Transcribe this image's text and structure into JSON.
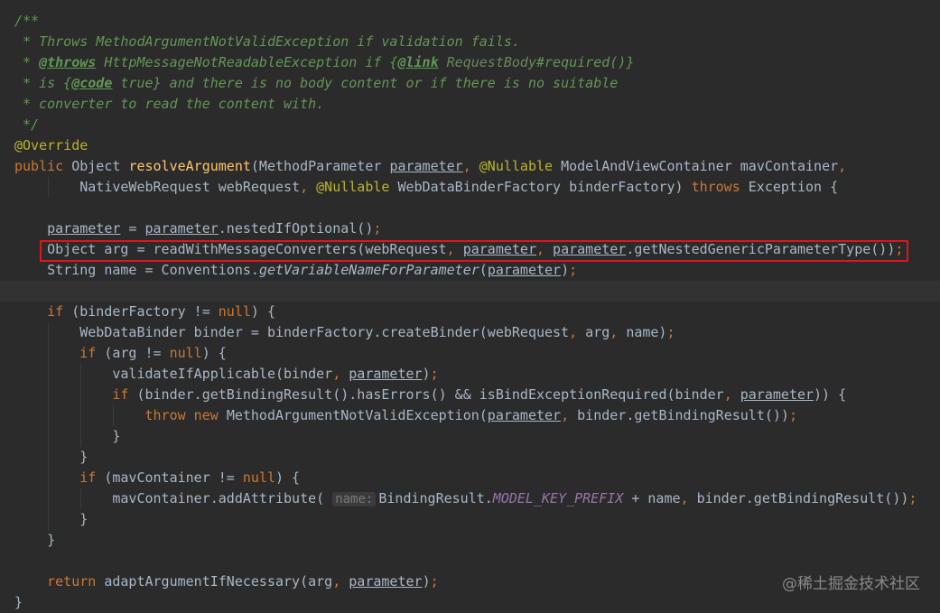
{
  "lines": [
    [
      {
        "t": "/**",
        "c": "doc"
      }
    ],
    [
      {
        "t": " * Throws MethodArgumentNotValidException if validation fails.",
        "c": "doc"
      }
    ],
    [
      {
        "t": " * ",
        "c": "doc"
      },
      {
        "t": "@throws",
        "c": "doctag"
      },
      {
        "t": " HttpMessageNotReadableException if {",
        "c": "doc"
      },
      {
        "t": "@link",
        "c": "doctag"
      },
      {
        "t": " ",
        "c": "doc"
      },
      {
        "t": "RequestBody",
        "c": "docref"
      },
      {
        "t": "#required()}",
        "c": "doc"
      }
    ],
    [
      {
        "t": " * is {",
        "c": "doc"
      },
      {
        "t": "@code",
        "c": "doctag"
      },
      {
        "t": " true} and there is no body content or if there is no suitable",
        "c": "doc"
      }
    ],
    [
      {
        "t": " * converter to read the content with.",
        "c": "doc"
      }
    ],
    [
      {
        "t": " */",
        "c": "doc"
      }
    ],
    [
      {
        "t": "@Override",
        "c": "ann"
      }
    ],
    [
      {
        "t": "public ",
        "c": "kw"
      },
      {
        "t": "Object ",
        "c": "plain"
      },
      {
        "t": "resolveArgument",
        "c": "method"
      },
      {
        "t": "(MethodParameter ",
        "c": "plain"
      },
      {
        "t": "parameter",
        "c": "param"
      },
      {
        "t": ", ",
        "c": "punct"
      },
      {
        "t": "@Nullable ",
        "c": "ann"
      },
      {
        "t": "ModelAndViewContainer mavContainer",
        "c": "plain"
      },
      {
        "t": ",",
        "c": "punct"
      }
    ],
    [
      {
        "t": "        NativeWebRequest webRequest",
        "c": "plain"
      },
      {
        "t": ", ",
        "c": "punct"
      },
      {
        "t": "@Nullable ",
        "c": "ann"
      },
      {
        "t": "WebDataBinderFactory binderFactory) ",
        "c": "plain"
      },
      {
        "t": "throws ",
        "c": "kw"
      },
      {
        "t": "Exception {",
        "c": "plain"
      }
    ],
    [],
    [
      {
        "t": "    ",
        "c": "plain"
      },
      {
        "t": "parameter",
        "c": "param"
      },
      {
        "t": " = ",
        "c": "plain"
      },
      {
        "t": "parameter",
        "c": "param"
      },
      {
        "t": ".nestedIfOptional()",
        "c": "plain"
      },
      {
        "t": ";",
        "c": "punct"
      }
    ],
    [
      {
        "t": "    Object arg = readWithMessageConverters(webRequest",
        "c": "plain"
      },
      {
        "t": ", ",
        "c": "punct"
      },
      {
        "t": "parameter",
        "c": "param"
      },
      {
        "t": ", ",
        "c": "punct"
      },
      {
        "t": "parameter",
        "c": "param"
      },
      {
        "t": ".getNestedGenericParameterType())",
        "c": "plain"
      },
      {
        "t": ";",
        "c": "punct"
      }
    ],
    [
      {
        "t": "    String name = Conventions.",
        "c": "plain"
      },
      {
        "t": "getVariableNameForParameter",
        "c": "staticm"
      },
      {
        "t": "(",
        "c": "plain"
      },
      {
        "t": "parameter",
        "c": "param"
      },
      {
        "t": ")",
        "c": "plain"
      },
      {
        "t": ";",
        "c": "punct"
      }
    ],
    [],
    [
      {
        "t": "    ",
        "c": "plain"
      },
      {
        "t": "if ",
        "c": "kw"
      },
      {
        "t": "(binderFactory != ",
        "c": "plain"
      },
      {
        "t": "null",
        "c": "kw"
      },
      {
        "t": ") {",
        "c": "plain"
      }
    ],
    [
      {
        "t": "        WebDataBinder binder = binderFactory.createBinder(webRequest",
        "c": "plain"
      },
      {
        "t": ", ",
        "c": "punct"
      },
      {
        "t": "arg",
        "c": "plain"
      },
      {
        "t": ", ",
        "c": "punct"
      },
      {
        "t": "name)",
        "c": "plain"
      },
      {
        "t": ";",
        "c": "punct"
      }
    ],
    [
      {
        "t": "        ",
        "c": "plain"
      },
      {
        "t": "if ",
        "c": "kw"
      },
      {
        "t": "(arg != ",
        "c": "plain"
      },
      {
        "t": "null",
        "c": "kw"
      },
      {
        "t": ") {",
        "c": "plain"
      }
    ],
    [
      {
        "t": "            validateIfApplicable(binder",
        "c": "plain"
      },
      {
        "t": ", ",
        "c": "punct"
      },
      {
        "t": "parameter",
        "c": "param"
      },
      {
        "t": ")",
        "c": "plain"
      },
      {
        "t": ";",
        "c": "punct"
      }
    ],
    [
      {
        "t": "            ",
        "c": "plain"
      },
      {
        "t": "if ",
        "c": "kw"
      },
      {
        "t": "(binder.getBindingResult().hasErrors() && isBindExceptionRequired(binder",
        "c": "plain"
      },
      {
        "t": ", ",
        "c": "punct"
      },
      {
        "t": "parameter",
        "c": "param"
      },
      {
        "t": ")) {",
        "c": "plain"
      }
    ],
    [
      {
        "t": "                ",
        "c": "plain"
      },
      {
        "t": "throw new ",
        "c": "kw"
      },
      {
        "t": "MethodArgumentNotValidException(",
        "c": "plain"
      },
      {
        "t": "parameter",
        "c": "param"
      },
      {
        "t": ", ",
        "c": "punct"
      },
      {
        "t": "binder.getBindingResult())",
        "c": "plain"
      },
      {
        "t": ";",
        "c": "punct"
      }
    ],
    [
      {
        "t": "            }",
        "c": "plain"
      }
    ],
    [
      {
        "t": "        }",
        "c": "plain"
      }
    ],
    [
      {
        "t": "        ",
        "c": "plain"
      },
      {
        "t": "if ",
        "c": "kw"
      },
      {
        "t": "(mavContainer != ",
        "c": "plain"
      },
      {
        "t": "null",
        "c": "kw"
      },
      {
        "t": ") {",
        "c": "plain"
      }
    ],
    [
      {
        "t": "            mavContainer.addAttribute( ",
        "c": "plain"
      },
      {
        "t": "name:",
        "c": "hint"
      },
      {
        "t": "BindingResult.",
        "c": "plain"
      },
      {
        "t": "MODEL_KEY_PREFIX",
        "c": "static"
      },
      {
        "t": " + name",
        "c": "plain"
      },
      {
        "t": ", ",
        "c": "punct"
      },
      {
        "t": "binder.getBindingResult())",
        "c": "plain"
      },
      {
        "t": ";",
        "c": "punct"
      }
    ],
    [
      {
        "t": "        }",
        "c": "plain"
      }
    ],
    [
      {
        "t": "    }",
        "c": "plain"
      }
    ],
    [],
    [
      {
        "t": "    ",
        "c": "plain"
      },
      {
        "t": "return ",
        "c": "kw"
      },
      {
        "t": "adaptArgumentIfNecessary(arg",
        "c": "plain"
      },
      {
        "t": ", ",
        "c": "punct"
      },
      {
        "t": "parameter",
        "c": "param"
      },
      {
        "t": ")",
        "c": "plain"
      },
      {
        "t": ";",
        "c": "punct"
      }
    ],
    [
      {
        "t": "}",
        "c": "plain"
      }
    ]
  ],
  "current_line": 13,
  "highlighted_line": 11,
  "watermark": "@稀土掘金技术社区",
  "colors": {
    "background": "#2b2b2b",
    "current_line": "#323232",
    "highlight_border": "#e0151b",
    "keyword": "#cc7832",
    "doc_comment": "#629755",
    "annotation": "#bbb529",
    "method_decl": "#ffc66d",
    "static_field": "#9876aa"
  }
}
